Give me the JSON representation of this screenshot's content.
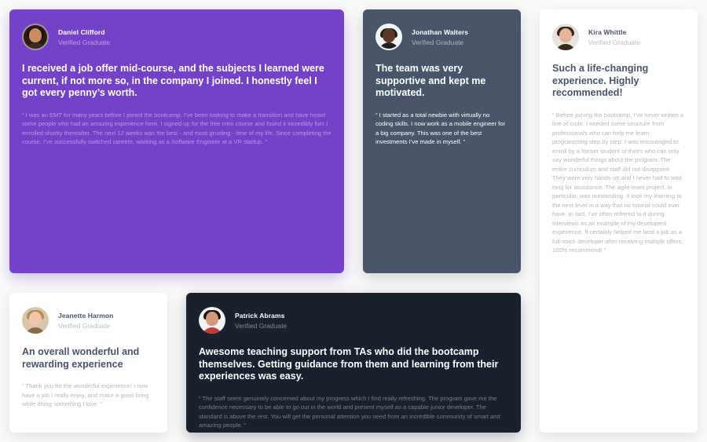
{
  "testimonials": [
    {
      "name": "Daniel Clifford",
      "role": "Verified Graduate",
      "headline": "I received a job offer mid-course, and the subjects I learned were current, if not more so, in the company I joined. I honestly feel I got every penny’s worth.",
      "quote": "“ I was an EMT for many years before I joined the bootcamp. I’ve been looking to make a transition and have heard some people who had an amazing experience here. I signed up for the free intro course and found it incredibly fun! I enrolled shortly thereafter. The next 12 weeks was the best - and most grueling - time of my life. Since completing the course, I’ve successfully switched careers, working as a Software Engineer at a VR startup. ”",
      "avatar_icon": "person-avatar-icon"
    },
    {
      "name": "Jonathan Walters",
      "role": "Verified Graduate",
      "headline": "The team was very supportive and kept me motivated.",
      "quote": "“ I started as a total newbie with virtually no coding skills. I now work as a mobile engineer for a big company. This was one of the best investments I’ve made in myself. ”",
      "avatar_icon": "person-avatar-icon"
    },
    {
      "name": "Kira Whittle",
      "role": "Verified Graduate",
      "headline": "Such a life-changing experience. Highly recommended!",
      "quote": "“ Before joining the bootcamp, I’ve never written a line of code. I needed some structure from professionals who can help me learn programming step by step. I was encouraged to enroll by a former student of theirs who can only say wonderful things about the program. The entire curriculum and staff did not disappoint. They were very hands-on and I never had to wait long for assistance. The agile team project, in particular, was outstanding. It took my learning to the next level in a way that no tutorial could ever have. In fact, I’ve often referred to it during interviews as an example of my developent experience. It certainly helped me land a job as a full-stack developer after receiving multiple offers. 100% recommend! ”",
      "avatar_icon": "person-avatar-icon"
    },
    {
      "name": "Jeanette Harmon",
      "role": "Verified Graduate",
      "headline": "An overall wonderful and rewarding experience",
      "quote": "“ Thank you for the wonderful experience! I now have a job I really enjoy, and make a good living while doing something I love. ”",
      "avatar_icon": "person-avatar-icon"
    },
    {
      "name": "Patrick Abrams",
      "role": "Verified Graduate",
      "headline": "Awesome teaching support from TAs who did the bootcamp themselves. Getting guidance from them and learning from their experiences was easy.",
      "quote": "“ The staff seem genuinely concerned about my progress which I find really refreshing. The program gave me the confidence necessary to be able to go out in the world and present myself as a capable junior developer. The standard is above the rest. You will get the personal attention you need from an incredible community of smart and amazing people. ”",
      "avatar_icon": "person-avatar-icon"
    }
  ],
  "colors": {
    "purple_card": "#7541c8",
    "gray_card": "#48556a",
    "white_card": "#ffffff",
    "dark_card": "#19212e",
    "page_background": "#fafafa"
  }
}
